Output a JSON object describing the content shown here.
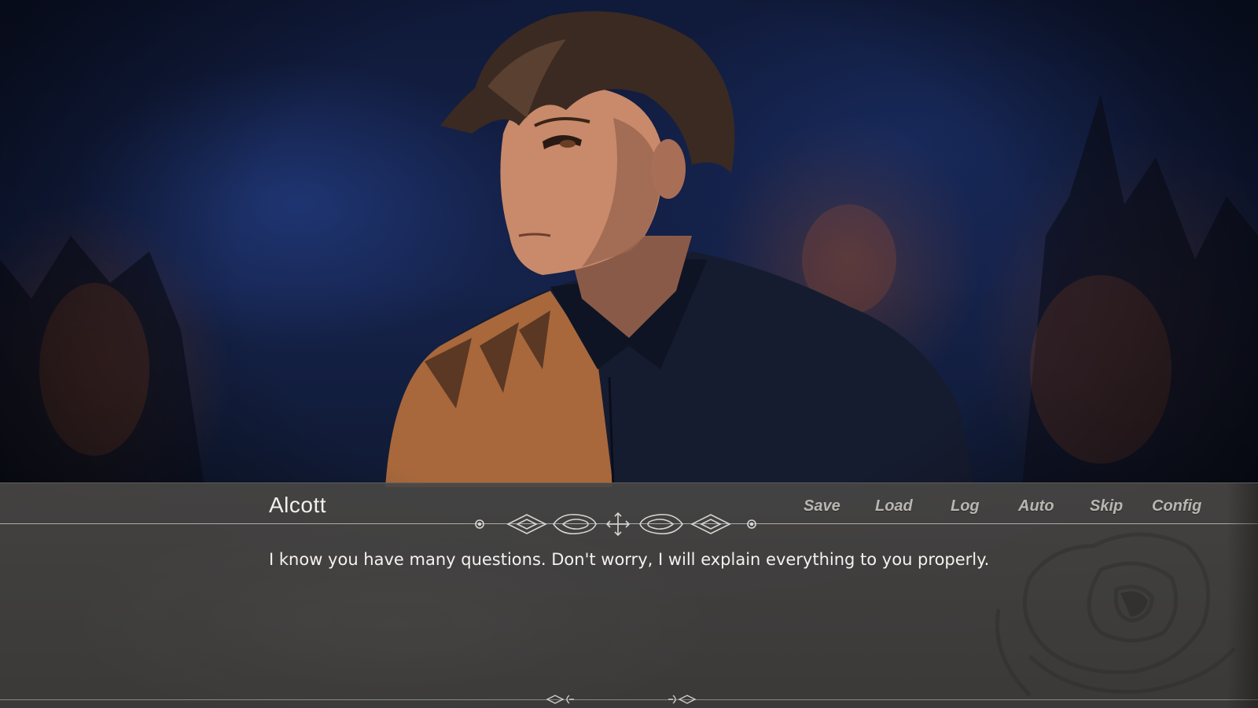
{
  "scene": {
    "character_name": "Alcott",
    "palette": {
      "sky": "#15224a",
      "fire": "#b4552a",
      "skin": "#c88a6a",
      "hair": "#3a2a22",
      "shirt": "#161c30"
    }
  },
  "dialogue": {
    "speaker": "Alcott",
    "text": "I know you have many questions. Don't worry, I will explain everything to you properly."
  },
  "quick_menu": {
    "items": [
      {
        "label": "Save"
      },
      {
        "label": "Load"
      },
      {
        "label": "Log"
      },
      {
        "label": "Auto"
      },
      {
        "label": "Skip"
      },
      {
        "label": "Config"
      }
    ]
  },
  "colors": {
    "dialogue_bg": "#46443f",
    "menu_text": "#b9b6b1",
    "dialogue_text": "#f4f2ee",
    "divider": "#d2d0cd"
  }
}
